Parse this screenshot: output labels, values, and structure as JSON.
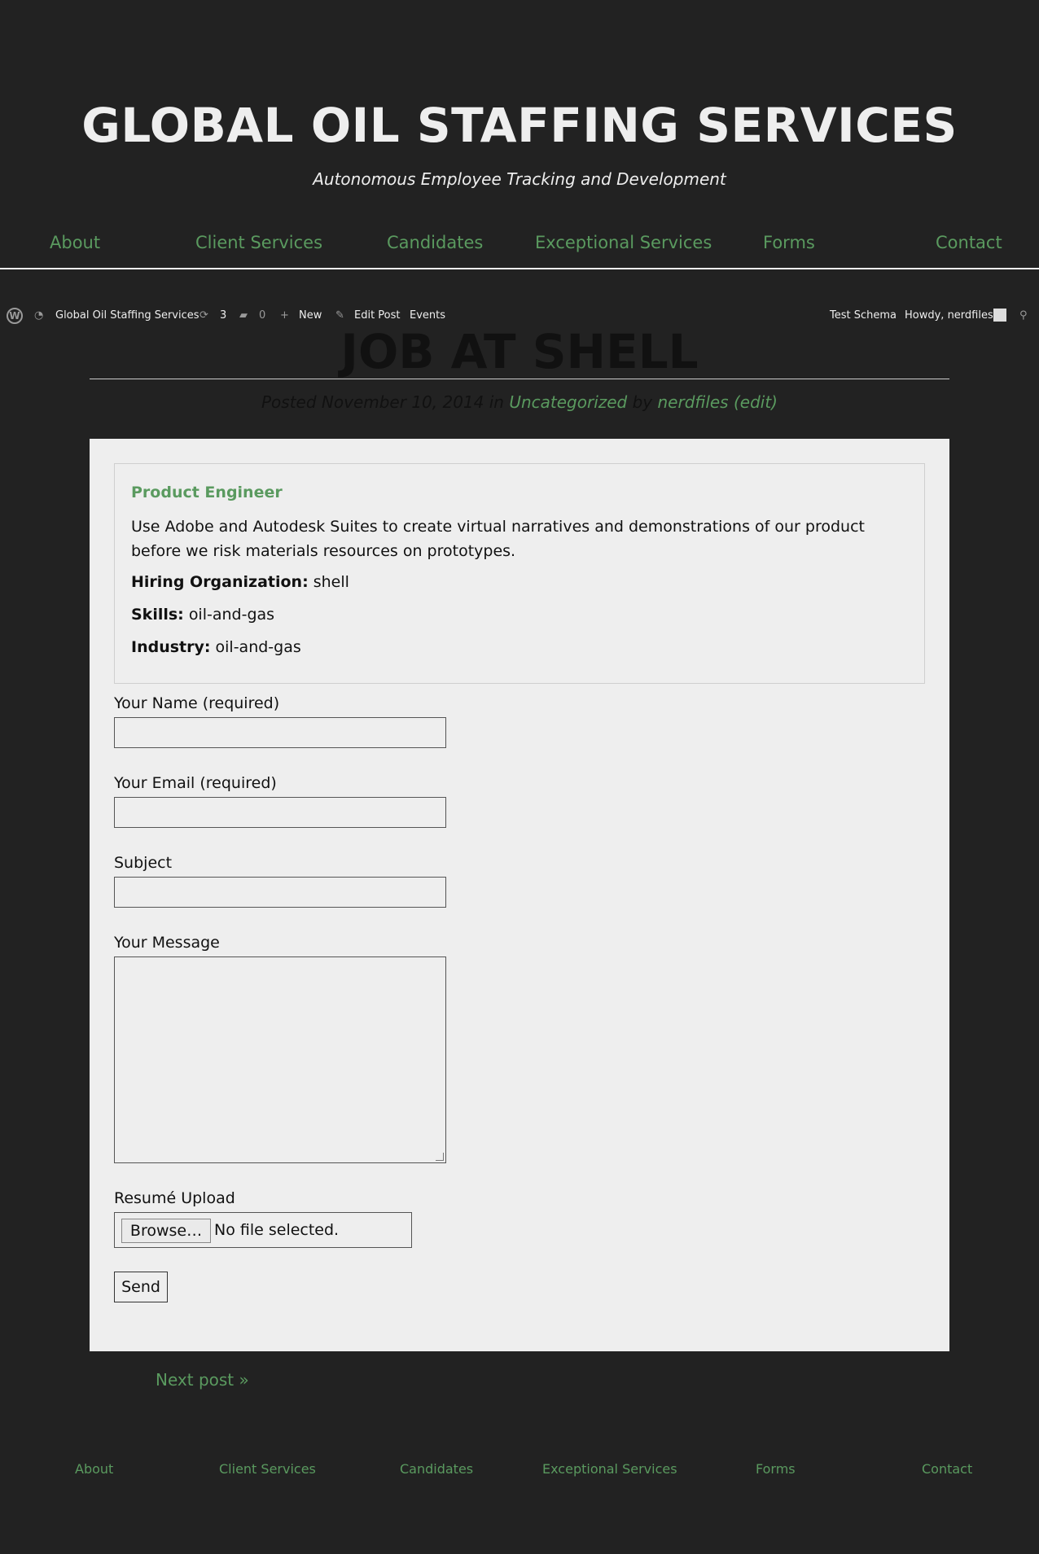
{
  "site": {
    "title": "GLOBAL OIL STAFFING SERVICES",
    "tagline": "Autonomous Employee Tracking and Development"
  },
  "nav": [
    "About",
    "Client Services",
    "Candidates",
    "Exceptional Services",
    "Forms",
    "Contact"
  ],
  "adminbar": {
    "wp_logo": "wordpress-icon",
    "site_name": "Global Oil Staffing Services",
    "updates_count": "3",
    "comments_count": "0",
    "new_label": "New",
    "edit_post_label": "Edit Post",
    "events_label": "Events",
    "test_schema_label": "Test Schema",
    "howdy_label": "Howdy, nerdfiles"
  },
  "post": {
    "title": "JOB AT SHELL",
    "meta": {
      "posted_prefix": "Posted November 10, 2014 in",
      "category": "Uncategorized",
      "by": "by",
      "author": "nerdfiles",
      "edit": "(edit)"
    }
  },
  "job": {
    "title": "Product Engineer",
    "description": "Use Adobe and Autodesk Suites to create virtual narratives and demonstrations of our product before we risk materials resources on prototypes.",
    "hiring_label": "Hiring Organization:",
    "hiring_value": "shell",
    "skills_label": "Skills:",
    "skills_value": "oil-and-gas",
    "industry_label": "Industry:",
    "industry_value": "oil-and-gas"
  },
  "form": {
    "name_label": "Your Name (required)",
    "email_label": "Your Email (required)",
    "subject_label": "Subject",
    "message_label": "Your Message",
    "resume_label": "Resumé Upload",
    "browse_label": "Browse…",
    "no_file_label": "No file selected.",
    "send_label": "Send"
  },
  "next_post": "Next post »",
  "colors": {
    "background": "#222222",
    "accent_green": "#5a9a5f",
    "content_bg": "#eeeeee"
  }
}
